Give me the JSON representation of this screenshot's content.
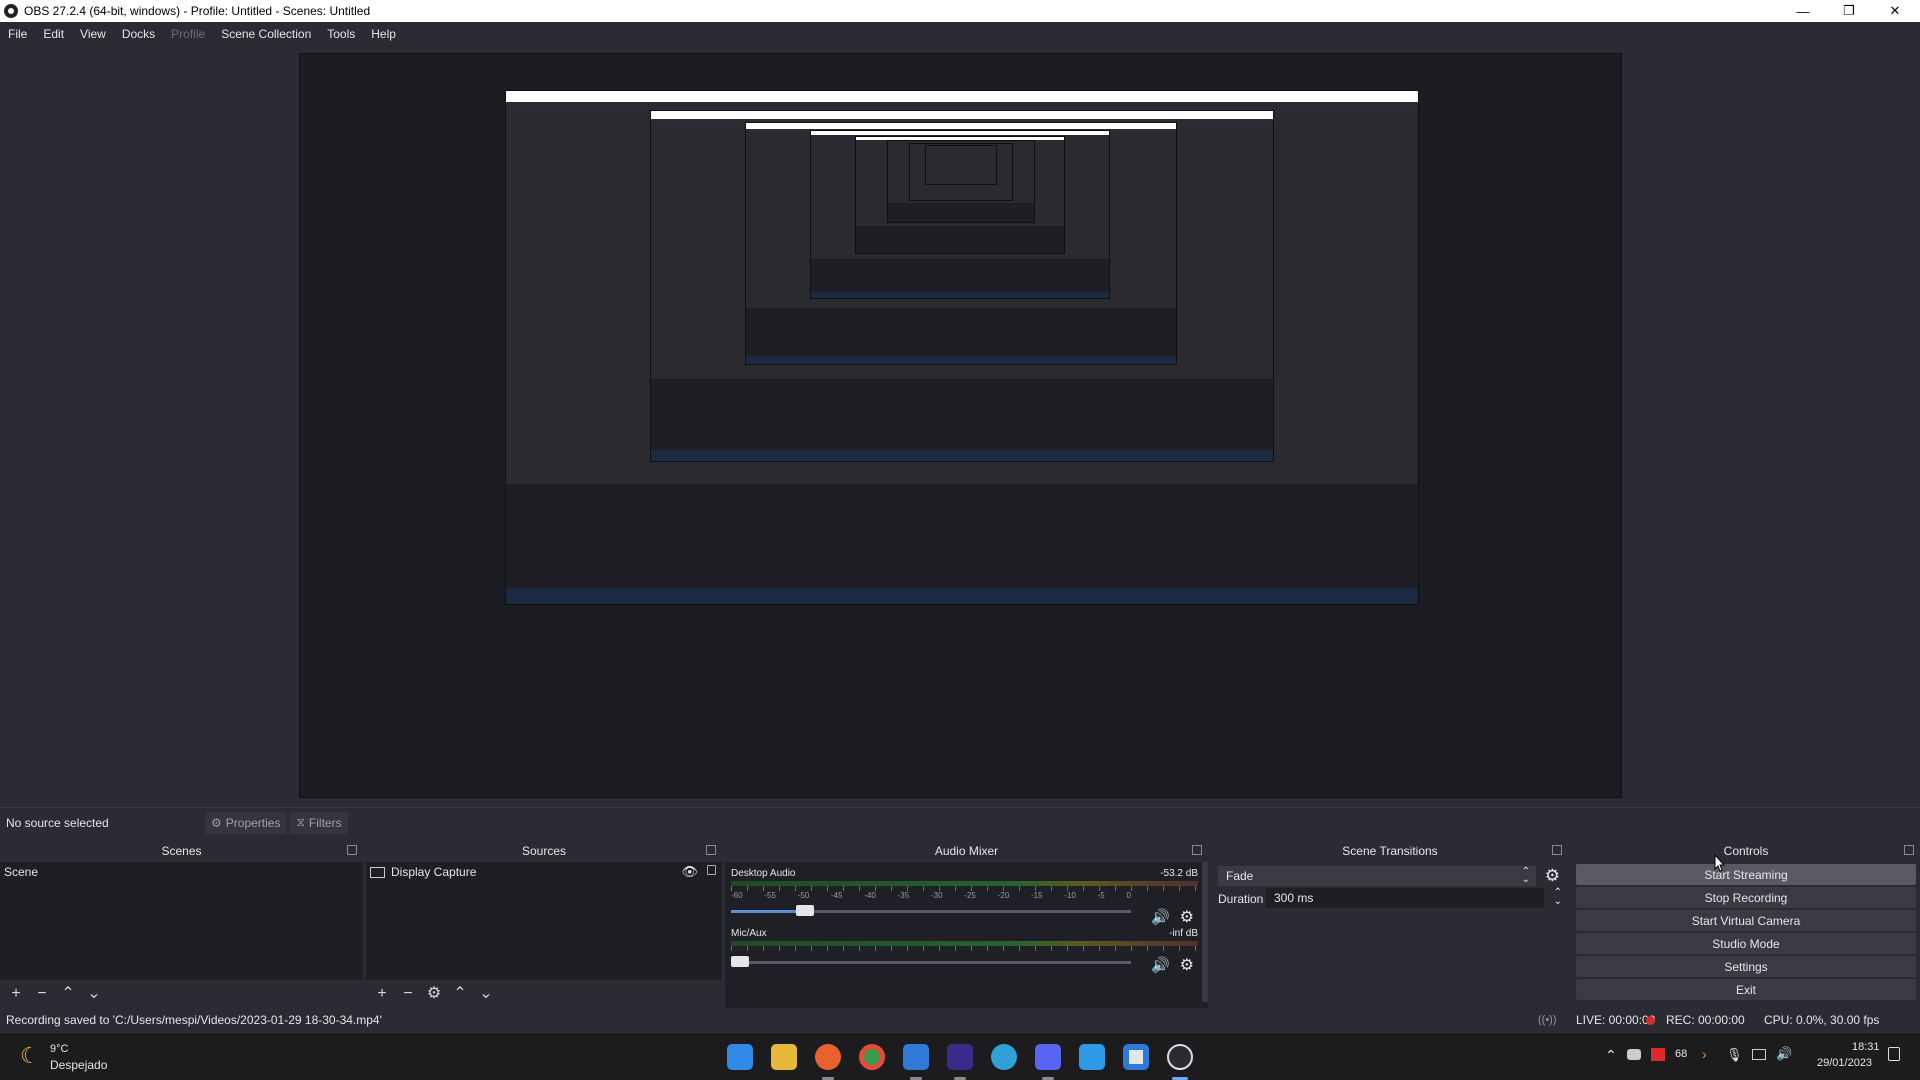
{
  "window": {
    "title": "OBS 27.2.4 (64-bit, windows) - Profile: Untitled - Scenes: Untitled",
    "controls": [
      "—",
      "❐",
      "✕"
    ]
  },
  "menu": [
    "File",
    "Edit",
    "View",
    "Docks",
    "Profile",
    "Scene Collection",
    "Tools",
    "Help"
  ],
  "source_toolbar": {
    "no_source": "No source selected",
    "properties": "Properties",
    "filters": "Filters"
  },
  "docks": {
    "scenes": {
      "title": "Scenes",
      "items": [
        "Scene"
      ]
    },
    "sources": {
      "title": "Sources",
      "items": [
        "Display Capture"
      ]
    },
    "audio_mixer": {
      "title": "Audio Mixer",
      "tracks": [
        {
          "name": "Desktop Audio",
          "level": "-53.2 dB",
          "volume": 0.17
        },
        {
          "name": "Mic/Aux",
          "level": "-inf dB",
          "volume": 0.0
        }
      ],
      "tick_labels": [
        "-60",
        "-55",
        "-50",
        "-45",
        "-40",
        "-35",
        "-30",
        "-25",
        "-20",
        "-15",
        "-10",
        "-5",
        "0"
      ]
    },
    "scene_transitions": {
      "title": "Scene Transitions",
      "transition": "Fade",
      "duration_label": "Duration",
      "duration_value": "300 ms"
    },
    "controls": {
      "title": "Controls",
      "buttons": [
        "Start Streaming",
        "Stop Recording",
        "Start Virtual Camera",
        "Studio Mode",
        "Settings",
        "Exit"
      ]
    }
  },
  "status": {
    "message": "Recording saved to 'C:/Users/mespi/Videos/2023-01-29 18-30-34.mp4'",
    "live": "LIVE: 00:00:00",
    "rec": "REC: 00:00:00",
    "cpu": "CPU: 0.0%, 30.00 fps"
  },
  "taskbar": {
    "weather_temp": "9°C",
    "weather_desc": "Despejado",
    "battery": "68",
    "time": "18:31",
    "date": "29/01/2023"
  },
  "colors": {
    "background": "#2b2c33",
    "panel": "#1e1f23",
    "accent": "#5a8fd8",
    "rec_red": "#d92b2b"
  }
}
